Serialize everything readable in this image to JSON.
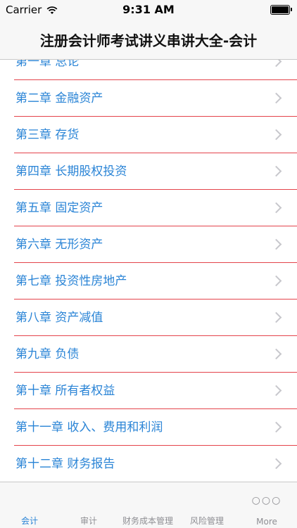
{
  "status_bar": {
    "carrier": "Carrier",
    "time": "9:31 AM"
  },
  "nav": {
    "title": "注册会计师考试讲义串讲大全-会计"
  },
  "chapters": [
    "第一章 总论",
    "第二章 金融资产",
    "第三章 存货",
    "第四章 长期股权投资",
    "第五章 固定资产",
    "第六章 无形资产",
    "第七章 投资性房地产",
    "第八章 资产减值",
    "第九章 负债",
    "第十章 所有者权益",
    "第十一章 收入、费用和利润",
    "第十二章 财务报告"
  ],
  "tabs": [
    {
      "label": "会计",
      "active": true
    },
    {
      "label": "审计",
      "active": false
    },
    {
      "label": "财务成本管理",
      "active": false
    },
    {
      "label": "风险管理",
      "active": false
    },
    {
      "label": "More",
      "active": false
    }
  ],
  "colors": {
    "accent": "#2a84d6",
    "divider": "#e4434b",
    "chevron": "#c7c7cc"
  },
  "icons": {
    "status": [
      "wifi-icon",
      "battery-icon"
    ],
    "row": "chevron-right-icon",
    "more": "more-dots-icon"
  }
}
